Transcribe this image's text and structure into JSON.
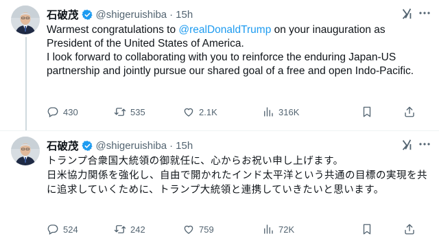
{
  "colors": {
    "accent": "#1d9bf0",
    "secondary_text": "#536471",
    "thread_line": "#cfd9de"
  },
  "posts": [
    {
      "author_name": "石破茂",
      "handle": "@shigeruishiba",
      "separator": "·",
      "time": "15h",
      "text_before": "Warmest congratulations to ",
      "mention": "@realDonaldTrump",
      "text_after": " on your inauguration as President of the United States of America.\nI look forward to collaborating with you to reinforce the enduring Japan-US partnership and jointly pursue our shared goal of a free and open Indo-Pacific.",
      "replies": "430",
      "reposts": "535",
      "likes": "2.1K",
      "views": "316K"
    },
    {
      "author_name": "石破茂",
      "handle": "@shigeruishiba",
      "separator": "·",
      "time": "15h",
      "text": "トランプ合衆国大統領の御就任に、心からお祝い申し上げます。\n日米協力関係を強化し、自由で開かれたインド太平洋という共通の目標の実現を共に追求していくために、トランプ大統領と連携していきたいと思います。",
      "replies": "524",
      "reposts": "242",
      "likes": "759",
      "views": "72K"
    }
  ],
  "icons": {
    "verified": "verified-badge-icon",
    "grok": "grok-icon",
    "more": "more-icon",
    "reply": "reply-icon",
    "repost": "repost-icon",
    "like": "like-icon",
    "views": "views-icon",
    "bookmark": "bookmark-icon",
    "share": "share-icon"
  }
}
